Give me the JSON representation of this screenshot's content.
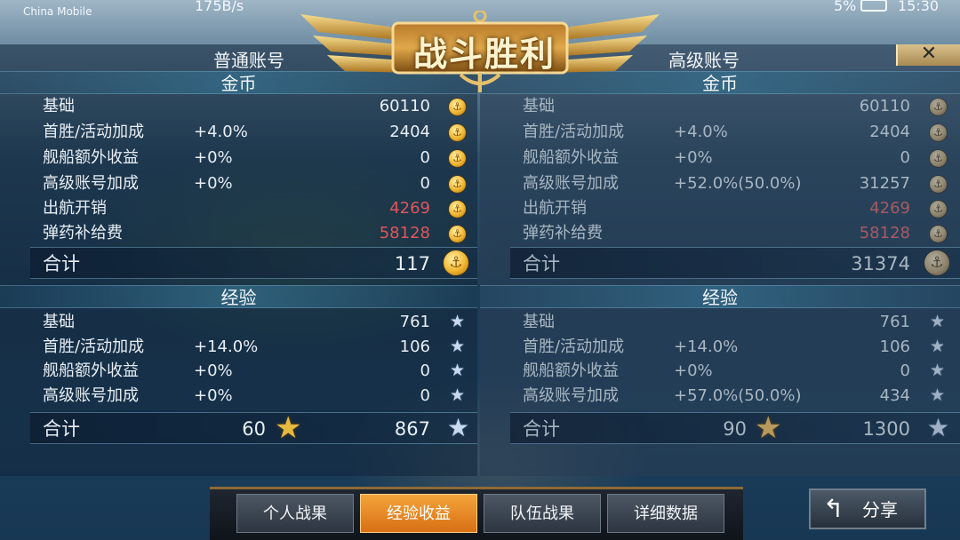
{
  "status_bar": {
    "carrier": "China Mobile",
    "speed": "175B/s",
    "battery": "5%",
    "time": "15:30"
  },
  "title": "战斗胜利",
  "close_label": "✕",
  "normal": {
    "title": "普通账号",
    "gold": {
      "header": "金币",
      "rows": [
        {
          "label": "基础",
          "pct": "",
          "value": "60110"
        },
        {
          "label": "首胜/活动加成",
          "pct": "+4.0%",
          "value": "2404"
        },
        {
          "label": "舰船额外收益",
          "pct": "+0%",
          "value": "0"
        },
        {
          "label": "高级账号加成",
          "pct": "+0%",
          "value": "0"
        },
        {
          "label": "出航开销",
          "pct": "",
          "value": "4269"
        },
        {
          "label": "弹药补给费",
          "pct": "",
          "value": "58128"
        }
      ],
      "total_label": "合计",
      "total": "117"
    },
    "exp": {
      "header": "经验",
      "rows": [
        {
          "label": "基础",
          "pct": "",
          "value": "761"
        },
        {
          "label": "首胜/活动加成",
          "pct": "+14.0%",
          "value": "106"
        },
        {
          "label": "舰船额外收益",
          "pct": "+0%",
          "value": "0"
        },
        {
          "label": "高级账号加成",
          "pct": "+0%",
          "value": "0"
        }
      ],
      "total_label": "合计",
      "captain": "60",
      "total": "867"
    }
  },
  "premium": {
    "title": "高级账号",
    "gold": {
      "header": "金币",
      "rows": [
        {
          "label": "基础",
          "pct": "",
          "value": "60110"
        },
        {
          "label": "首胜/活动加成",
          "pct": "+4.0%",
          "value": "2404"
        },
        {
          "label": "舰船额外收益",
          "pct": "+0%",
          "value": "0"
        },
        {
          "label": "高级账号加成",
          "pct": "+52.0%(50.0%)",
          "value": "31257"
        },
        {
          "label": "出航开销",
          "pct": "",
          "value": "4269"
        },
        {
          "label": "弹药补给费",
          "pct": "",
          "value": "58128"
        }
      ],
      "total_label": "合计",
      "total": "31374"
    },
    "exp": {
      "header": "经验",
      "rows": [
        {
          "label": "基础",
          "pct": "",
          "value": "761"
        },
        {
          "label": "首胜/活动加成",
          "pct": "+14.0%",
          "value": "106"
        },
        {
          "label": "舰船额外收益",
          "pct": "+0%",
          "value": "0"
        },
        {
          "label": "高级账号加成",
          "pct": "+57.0%(50.0%)",
          "value": "434"
        }
      ],
      "total_label": "合计",
      "captain": "90",
      "total": "1300"
    }
  },
  "tabs": [
    {
      "label": "个人战果",
      "active": false
    },
    {
      "label": "经验收益",
      "active": true
    },
    {
      "label": "队伍战果",
      "active": false
    },
    {
      "label": "详细数据",
      "active": false
    }
  ],
  "share_label": "分享",
  "colors": {
    "expense": "#e0555c",
    "active_tab": "#e98a24",
    "gold": "#f0b52f"
  },
  "icons": {
    "coin": "coin-icon",
    "star": "star-icon",
    "captain": "captain-star-icon",
    "close": "close-icon",
    "share": "share-arrow-icon"
  }
}
